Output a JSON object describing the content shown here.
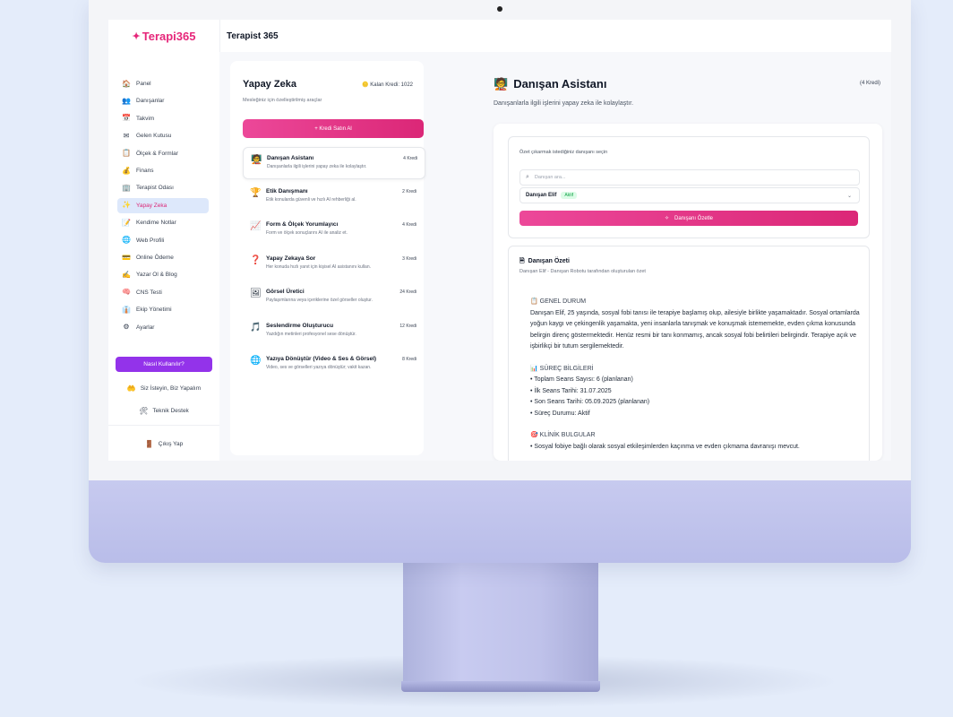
{
  "app": {
    "logo": "Terapi365",
    "page_title": "Terapist 365"
  },
  "sidebar": {
    "items": [
      {
        "icon": "home-icon",
        "glyph": "🏠",
        "label": "Panel"
      },
      {
        "icon": "clients-icon",
        "glyph": "👥",
        "label": "Danışanlar"
      },
      {
        "icon": "calendar-icon",
        "glyph": "📅",
        "label": "Takvim"
      },
      {
        "icon": "inbox-icon",
        "glyph": "✉",
        "label": "Gelen Kutusu"
      },
      {
        "icon": "forms-icon",
        "glyph": "📋",
        "label": "Ölçek & Formlar"
      },
      {
        "icon": "finance-icon",
        "glyph": "💰",
        "label": "Finans"
      },
      {
        "icon": "room-icon",
        "glyph": "🏢",
        "label": "Terapist Odası"
      },
      {
        "icon": "ai-icon",
        "glyph": "✨",
        "label": "Yapay Zeka"
      },
      {
        "icon": "notes-icon",
        "glyph": "📝",
        "label": "Kendime Notlar"
      },
      {
        "icon": "web-icon",
        "glyph": "🌐",
        "label": "Web Profili"
      },
      {
        "icon": "payment-icon",
        "glyph": "💳",
        "label": "Online Ödeme"
      },
      {
        "icon": "blog-icon",
        "glyph": "✍",
        "label": "Yazar Ol & Blog"
      },
      {
        "icon": "cns-icon",
        "glyph": "🧠",
        "label": "CNS Testi"
      },
      {
        "icon": "team-icon",
        "glyph": "👔",
        "label": "Ekip Yönetimi"
      },
      {
        "icon": "settings-icon",
        "glyph": "⚙",
        "label": "Ayarlar"
      }
    ],
    "active_index": 7,
    "howto_label": "Nasıl Kullanılır?",
    "request_label": "Siz İsteyin, Biz Yapalım",
    "support_label": "Teknik Destek",
    "logout_label": "Çıkış Yap"
  },
  "ai_panel": {
    "title": "Yapay Zeka",
    "subtitle": "Mesleğiniz için özelleştirilmiş araçlar",
    "credit": "Kalan Kredi: 1022",
    "buy_label": "+ Kredi Satın Al",
    "tools": [
      {
        "icon": "assistant-icon",
        "glyph": "🧑‍🏫",
        "name": "Danışan Asistanı",
        "desc": "Danışanlarla ilgili işlerini yapay zeka ile kolaylaştır.",
        "cost": "4 Kredi"
      },
      {
        "icon": "ethics-icon",
        "glyph": "🏆",
        "name": "Etik Danışmanı",
        "desc": "Etik konularda güvenli ve hızlı AI rehberliği al.",
        "cost": "2 Kredi"
      },
      {
        "icon": "form-scale-icon",
        "glyph": "📈",
        "name": "Form & Ölçek Yorumlayıcı",
        "desc": "Form ve ölçek sonuçlarını AI ile analiz et.",
        "cost": "4 Kredi"
      },
      {
        "icon": "ask-ai-icon",
        "glyph": "❓",
        "name": "Yapay Zekaya Sor",
        "desc": "Her konuda hızlı yanıt için kişisel AI asistanını kullan.",
        "cost": "3 Kredi"
      },
      {
        "icon": "image-gen-icon",
        "glyph": "🖼",
        "name": "Görsel Üretici",
        "desc": "Paylaşımlarına veya içeriklerine özel görseller oluştur.",
        "cost": "24 Kredi"
      },
      {
        "icon": "voiceover-icon",
        "glyph": "🎵",
        "name": "Seslendirme Oluşturucu",
        "desc": "Yazdığın metinleri profesyonel sese dönüştür.",
        "cost": "12 Kredi"
      },
      {
        "icon": "transcribe-icon",
        "glyph": "🌐",
        "name": "Yazıya Dönüştür (Video & Ses & Görsel)",
        "desc": "Video, ses ve görselleri yazıya dönüştür; vakit kazan.",
        "cost": "8 Kredi"
      }
    ],
    "active_tool_index": 0
  },
  "assistant": {
    "icon": "assistant-icon",
    "glyph": "🧑‍🏫",
    "title": "Danışan Asistanı",
    "credit": "(4 Kredi)",
    "subtitle": "Danışanlarla ilgili işlerini yapay zeka ile kolaylaştır.",
    "select_label": "Özet çıkarmak istediğiniz danışanı seçin",
    "search_placeholder": "Danışan ara...",
    "selected_client": "Danışan Elif",
    "selected_status": "Aktif",
    "summarize_label": "Danışanı Özetle"
  },
  "summary": {
    "title": "Danışan Özeti",
    "subtitle": "Danışan Elif - Danışan Robotu tarafından oluşturulan özet",
    "general_header": "📋 GENEL DURUM",
    "general_text": "Danışan Elif, 25 yaşında, sosyal fobi tanısı ile terapiye başlamış olup, ailesiyle birlikte yaşamaktadır. Sosyal ortamlarda yoğun kaygı ve çekingenlik yaşamakta, yeni insanlarla tanışmak ve konuşmak istememekte, evden çıkma konusunda belirgin direnç göstermektedir. Henüz resmi bir tanı konmamış, ancak sosyal fobi belirtileri belirgindir. Terapiye açık ve işbirlikçi bir tutum sergilemektedir.",
    "process_header": "📊 SÜREÇ BİLGİLERİ",
    "process_lines": [
      "• Toplam Seans Sayısı: 6 (planlanan)",
      "• İlk Seans Tarihi: 31.07.2025",
      "• Son Seans Tarihi: 05.09.2025 (planlanan)",
      "• Süreç Durumu: Aktif"
    ],
    "clinical_header": "🎯 KLİNİK BULGULAR",
    "clinical_lines": [
      "• Sosyal fobiye bağlı olarak sosyal etkileşimlerden kaçınma ve evden çıkmama davranışı mevcut."
    ]
  },
  "colors": {
    "brand": "#e6277a",
    "purple": "#9333ea",
    "active_bg": "#dde8fb"
  }
}
